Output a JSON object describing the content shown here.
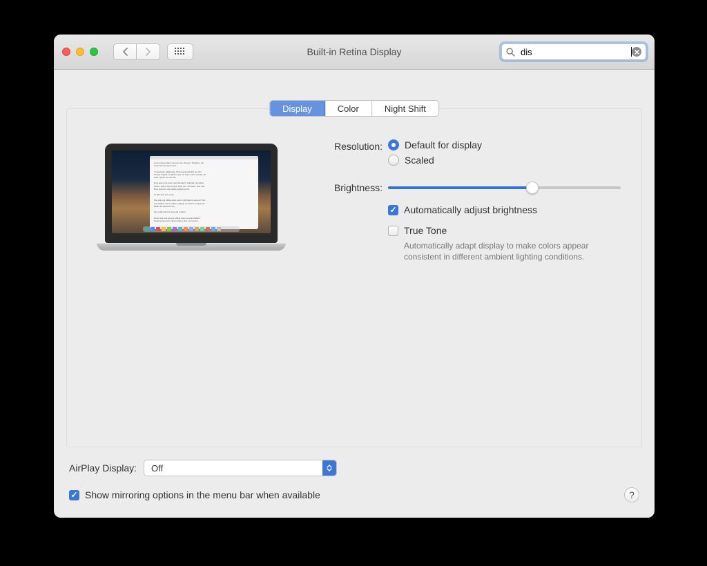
{
  "window": {
    "title": "Built-in Retina Display"
  },
  "search": {
    "value": "dis"
  },
  "tabs": [
    {
      "label": "Display",
      "active": true
    },
    {
      "label": "Color",
      "active": false
    },
    {
      "label": "Night Shift",
      "active": false
    }
  ],
  "resolution": {
    "label": "Resolution:",
    "options": {
      "default": "Default for display",
      "scaled": "Scaled"
    },
    "selected": "default"
  },
  "brightness": {
    "label": "Brightness:",
    "value": 62,
    "auto_label": "Automatically adjust brightness",
    "auto_checked": true
  },
  "truetone": {
    "label": "True Tone",
    "checked": false,
    "help": "Automatically adapt display to make colors appear consistent in different ambient lighting conditions."
  },
  "airplay": {
    "label": "AirPlay Display:",
    "value": "Off"
  },
  "mirroring": {
    "label": "Show mirroring options in the menu bar when available",
    "checked": true
  },
  "help_button": "?"
}
